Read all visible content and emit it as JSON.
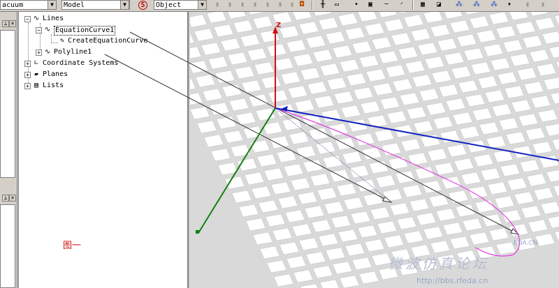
{
  "toolbar": {
    "material_combo": "acuum",
    "space_combo": "Model",
    "select_combo": "Object",
    "icons": [
      "snap-s-icon",
      "disabled-tool-icon",
      "bucket-icon",
      "ruler-icon",
      "rectangle-select-icon",
      "point-icon",
      "box-icon",
      "arc-icon",
      "grid-icon",
      "view-icon",
      "tree-nodes-icon"
    ]
  },
  "tree": {
    "items": [
      {
        "label": "Lines",
        "expand": "−",
        "icon": "curve-icon"
      },
      {
        "label": "EquationCurve1",
        "expand": "−",
        "icon": "curve-icon"
      },
      {
        "label": "CreateEquationCurve",
        "expand": "",
        "icon": "create-curve-icon"
      },
      {
        "label": "Polyline1",
        "expand": "+",
        "icon": "curve-icon"
      },
      {
        "label": "Coordinate Systems",
        "expand": "+",
        "icon": "coordinate-icon"
      },
      {
        "label": "Planes",
        "expand": "+",
        "icon": "planes-icon"
      },
      {
        "label": "Lists",
        "expand": "+",
        "icon": "lists-icon"
      }
    ],
    "annotation": "图一"
  },
  "viewport": {
    "axis_z_label": "Z",
    "watermark_title": "微波仿真论坛",
    "watermark_url": "http://bbs.rfeda.cn",
    "watermark_brand": "EDA.CN"
  }
}
